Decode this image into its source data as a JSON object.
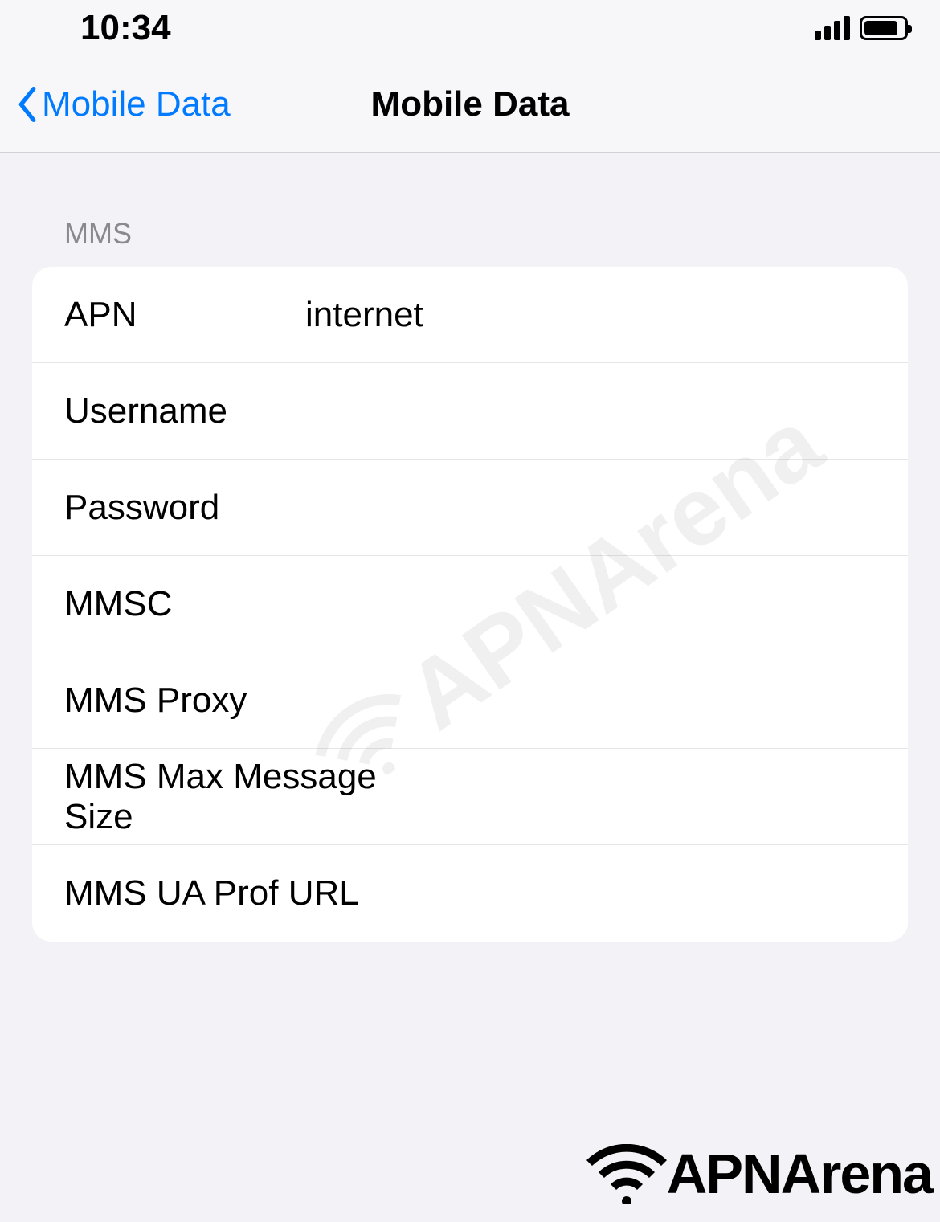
{
  "status_bar": {
    "time": "10:34"
  },
  "nav": {
    "back_label": "Mobile Data",
    "title": "Mobile Data"
  },
  "section": {
    "header": "MMS",
    "rows": [
      {
        "label": "APN",
        "value": "internet",
        "wide": false
      },
      {
        "label": "Username",
        "value": "",
        "wide": false
      },
      {
        "label": "Password",
        "value": "",
        "wide": false
      },
      {
        "label": "MMSC",
        "value": "",
        "wide": false
      },
      {
        "label": "MMS Proxy",
        "value": "",
        "wide": false
      },
      {
        "label": "MMS Max Message Size",
        "value": "",
        "wide": true
      },
      {
        "label": "MMS UA Prof URL",
        "value": "",
        "wide": true
      }
    ]
  },
  "watermark": {
    "text": "APNArena"
  },
  "footer": {
    "text": "APNArena"
  }
}
